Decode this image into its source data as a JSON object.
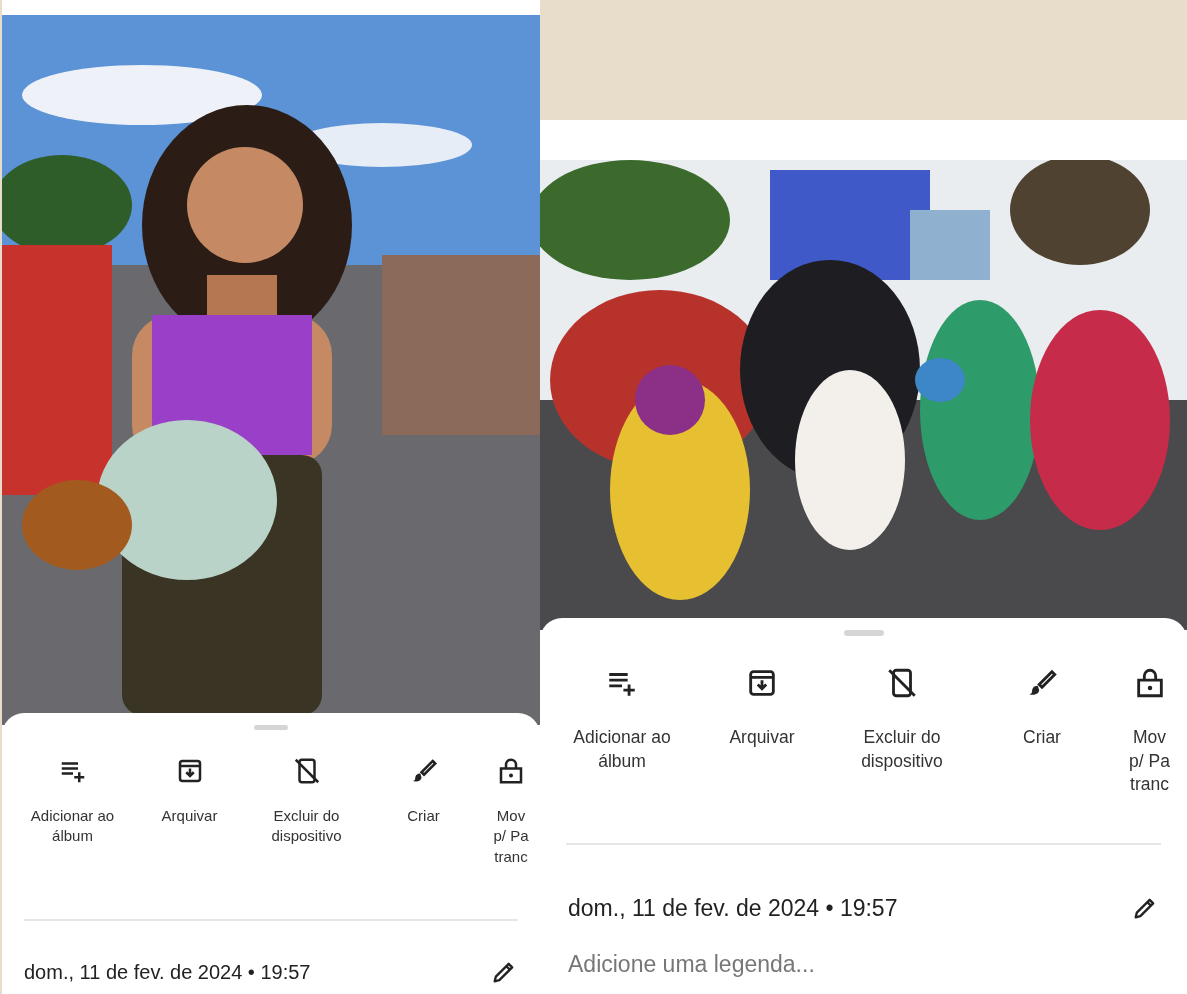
{
  "panels": [
    {
      "actions": [
        {
          "kind": "add-to-album",
          "label": "Adicionar ao álbum"
        },
        {
          "kind": "archive",
          "label": "Arquivar"
        },
        {
          "kind": "delete-from-device",
          "label": "Excluir do dispositivo"
        },
        {
          "kind": "create",
          "label": "Criar"
        },
        {
          "kind": "move-locked",
          "label": "Mov\np/ Pa\ntranc"
        }
      ],
      "date": "dom., 11 de fev. de 2024 • 19:57"
    },
    {
      "actions": [
        {
          "kind": "add-to-album",
          "label": "Adicionar ao álbum"
        },
        {
          "kind": "archive",
          "label": "Arquivar"
        },
        {
          "kind": "delete-from-device",
          "label": "Excluir do dispositivo"
        },
        {
          "kind": "create",
          "label": "Criar"
        },
        {
          "kind": "move-locked",
          "label": "Mov\np/ Pa\ntranc"
        }
      ],
      "date": "dom., 11 de fev. de 2024 • 19:57",
      "caption": {
        "placeholder": "Adicione uma legenda..."
      }
    }
  ]
}
